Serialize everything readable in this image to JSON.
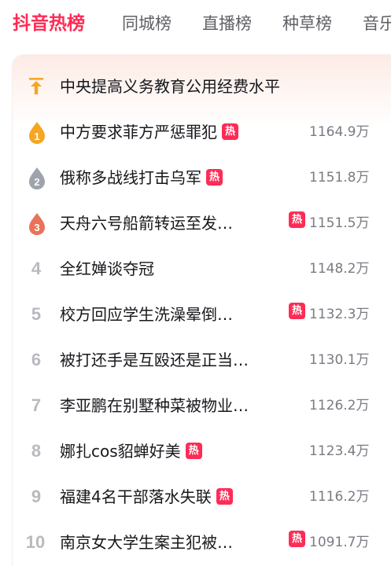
{
  "tabs": [
    "抖音热榜",
    "同城榜",
    "直播榜",
    "种草榜",
    "音乐榜"
  ],
  "active_tab": "抖音热榜",
  "hot_badge": "热",
  "pinned": {
    "title": "中央提高义务教育公用经费水平"
  },
  "rows": [
    {
      "rank": "1",
      "title": "中方要求菲方严惩罪犯",
      "hot": true,
      "count": "1164.9万"
    },
    {
      "rank": "2",
      "title": "俄称多战线打击乌军",
      "hot": true,
      "count": "1151.8万"
    },
    {
      "rank": "3",
      "title": "天舟六号船箭转运至发…",
      "hot": true,
      "count": "1151.5万"
    },
    {
      "rank": "4",
      "title": "全红婵谈夺冠",
      "hot": false,
      "count": "1148.2万"
    },
    {
      "rank": "5",
      "title": "校方回应学生洗澡晕倒…",
      "hot": true,
      "count": "1132.3万"
    },
    {
      "rank": "6",
      "title": "被打还手是互殴还是正当…",
      "hot": false,
      "count": "1130.1万"
    },
    {
      "rank": "7",
      "title": "李亚鹏在别墅种菜被物业…",
      "hot": false,
      "count": "1126.2万"
    },
    {
      "rank": "8",
      "title": "娜扎cos貂蝉好美",
      "hot": true,
      "count": "1123.4万"
    },
    {
      "rank": "9",
      "title": "福建4名干部落水失联",
      "hot": true,
      "count": "1116.2万"
    },
    {
      "rank": "10",
      "title": "南京女大学生案主犯被…",
      "hot": true,
      "count": "1091.7万"
    }
  ],
  "colors": {
    "accent": "#fe2c55",
    "gold": "#f5a623",
    "silver": "#9ea3ad",
    "bronze": "#e8735a"
  }
}
